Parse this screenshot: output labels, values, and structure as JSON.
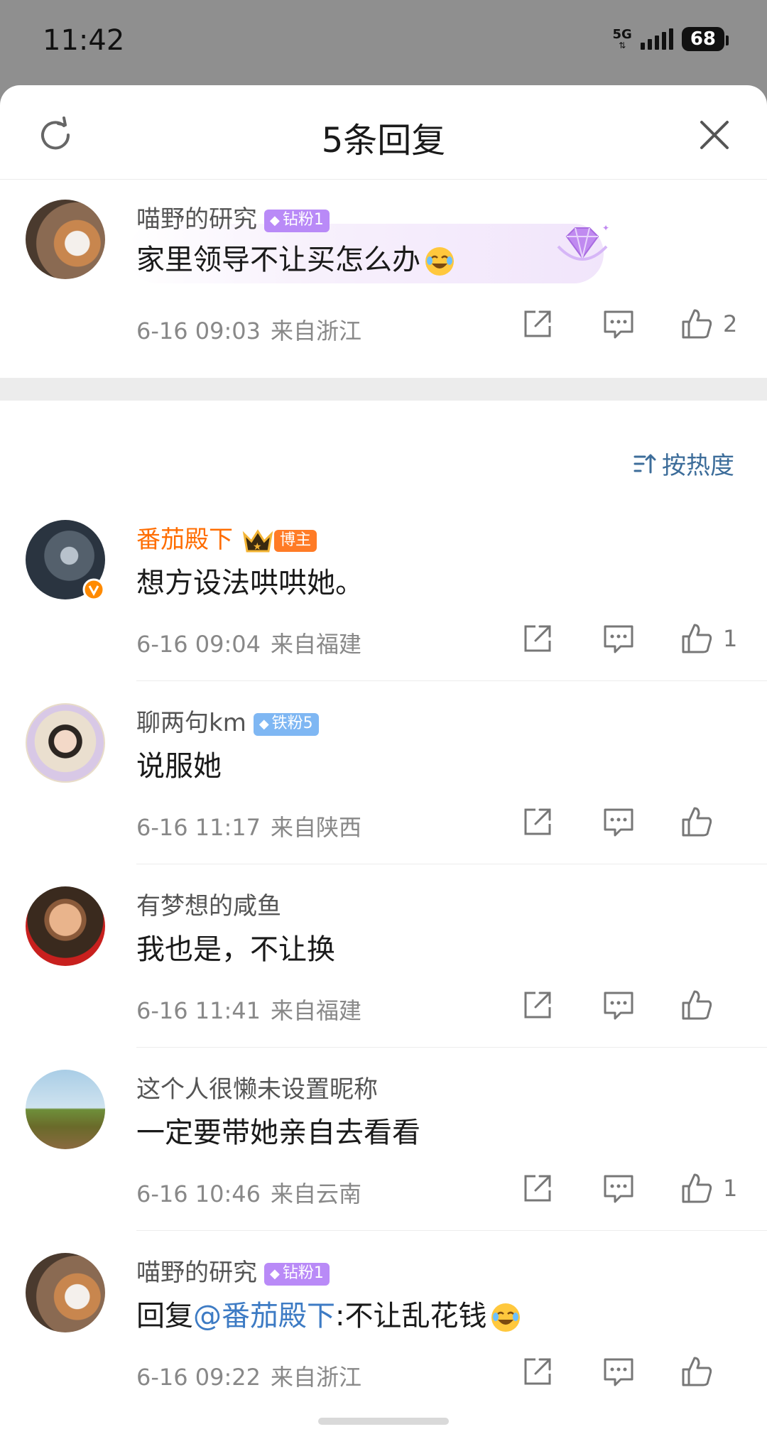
{
  "status_bar": {
    "time": "11:42",
    "network": "5G",
    "battery": "68"
  },
  "header": {
    "title": "5条回复"
  },
  "root_comment": {
    "user": "喵野的研究",
    "badge": "钻粉1",
    "text": "家里领导不让买怎么办",
    "date": "6-16 09:03",
    "location": "来自浙江",
    "likes": "2"
  },
  "sort_label": "按热度",
  "replies": [
    {
      "user": "番茄殿下",
      "badge": "博主",
      "text": "想方设法哄哄她。",
      "date": "6-16 09:04",
      "location": "来自福建",
      "likes": "1"
    },
    {
      "user": "聊两句km",
      "badge": "铁粉5",
      "text": "说服她",
      "date": "6-16 11:17",
      "location": "来自陕西",
      "likes": ""
    },
    {
      "user": "有梦想的咸鱼",
      "badge": "",
      "text": "我也是，不让换",
      "date": "6-16 11:41",
      "location": "来自福建",
      "likes": ""
    },
    {
      "user": "这个人很懒未设置昵称",
      "badge": "",
      "text": "一定要带她亲自去看看",
      "date": "6-16 10:46",
      "location": "来自云南",
      "likes": "1"
    },
    {
      "user": "喵野的研究",
      "badge": "钻粉1",
      "text_prefix": "回复",
      "mention": "@番茄殿下",
      "text": ":不让乱花钱",
      "date": "6-16 09:22",
      "location": "来自浙江",
      "likes": ""
    }
  ],
  "colors": {
    "accent_blue": "#3d7bc4",
    "blogger_orange": "#ff6d00",
    "badge_purple": "#b98af7",
    "badge_blue": "#7fb7f3"
  },
  "icons": [
    "refresh-icon",
    "close-icon",
    "share-icon",
    "comment-icon",
    "like-icon",
    "sort-icon",
    "laughing-emoji-icon",
    "diamond-icon",
    "crown-icon",
    "verified-icon"
  ]
}
